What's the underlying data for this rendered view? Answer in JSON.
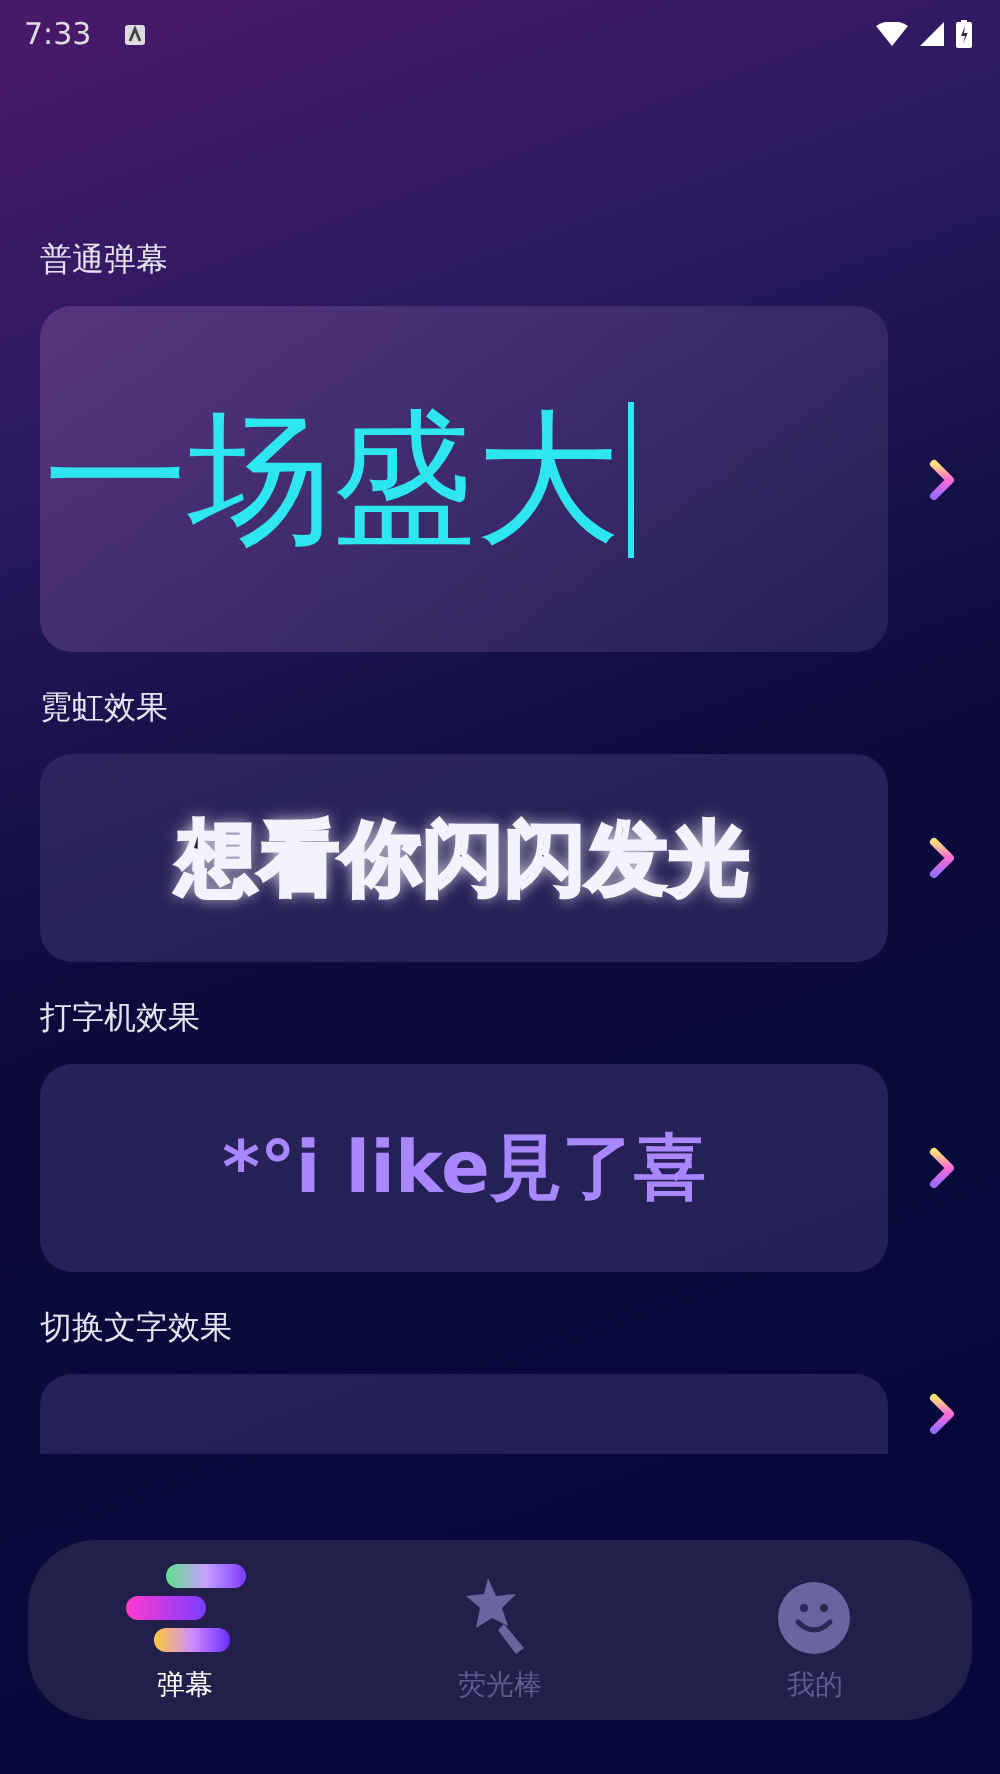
{
  "status_bar": {
    "time": "7:33"
  },
  "sections": [
    {
      "label": "普通弹幕",
      "kind": "plain",
      "preview": "一场盛大"
    },
    {
      "label": "霓虹效果",
      "kind": "neon",
      "preview": "想看你闪闪发光"
    },
    {
      "label": "打字机效果",
      "kind": "typewriter",
      "preview": "*°i like見了喜"
    },
    {
      "label": "切换文字效果",
      "kind": "switch"
    }
  ],
  "bottom_nav": [
    {
      "label": "弹幕",
      "selected": true,
      "kind": "bars"
    },
    {
      "label": "荧光棒",
      "selected": false,
      "kind": "wand"
    },
    {
      "label": "我的",
      "selected": false,
      "kind": "smile"
    }
  ]
}
